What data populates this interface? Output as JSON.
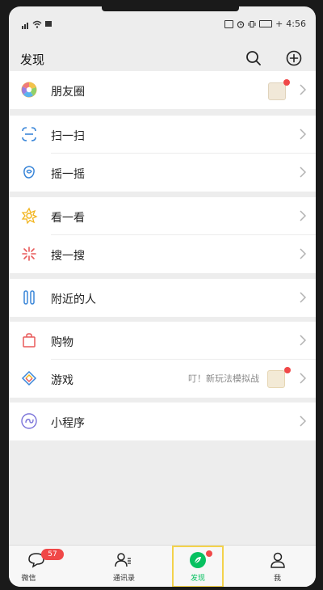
{
  "statusbar": {
    "time": "4:56",
    "battery_percent_label": "+"
  },
  "header": {
    "title": "发现"
  },
  "menu": {
    "moments": {
      "label": "朋友圈"
    },
    "scan": {
      "label": "扫一扫"
    },
    "shake": {
      "label": "摇一摇"
    },
    "top_stories": {
      "label": "看一看"
    },
    "search": {
      "label": "搜一搜"
    },
    "nearby": {
      "label": "附近的人"
    },
    "shopping": {
      "label": "购物"
    },
    "games": {
      "label": "游戏",
      "promo_text": "叮！新玩法模拟战"
    },
    "mini_programs": {
      "label": "小程序"
    }
  },
  "tabbar": {
    "chats": {
      "label": "微信",
      "badge": "57"
    },
    "contacts": {
      "label": "通讯录"
    },
    "discover": {
      "label": "发现"
    },
    "me": {
      "label": "我"
    }
  },
  "colors": {
    "accent_green": "#07c160",
    "badge_red": "#f04848",
    "page_bg": "#ededed"
  }
}
